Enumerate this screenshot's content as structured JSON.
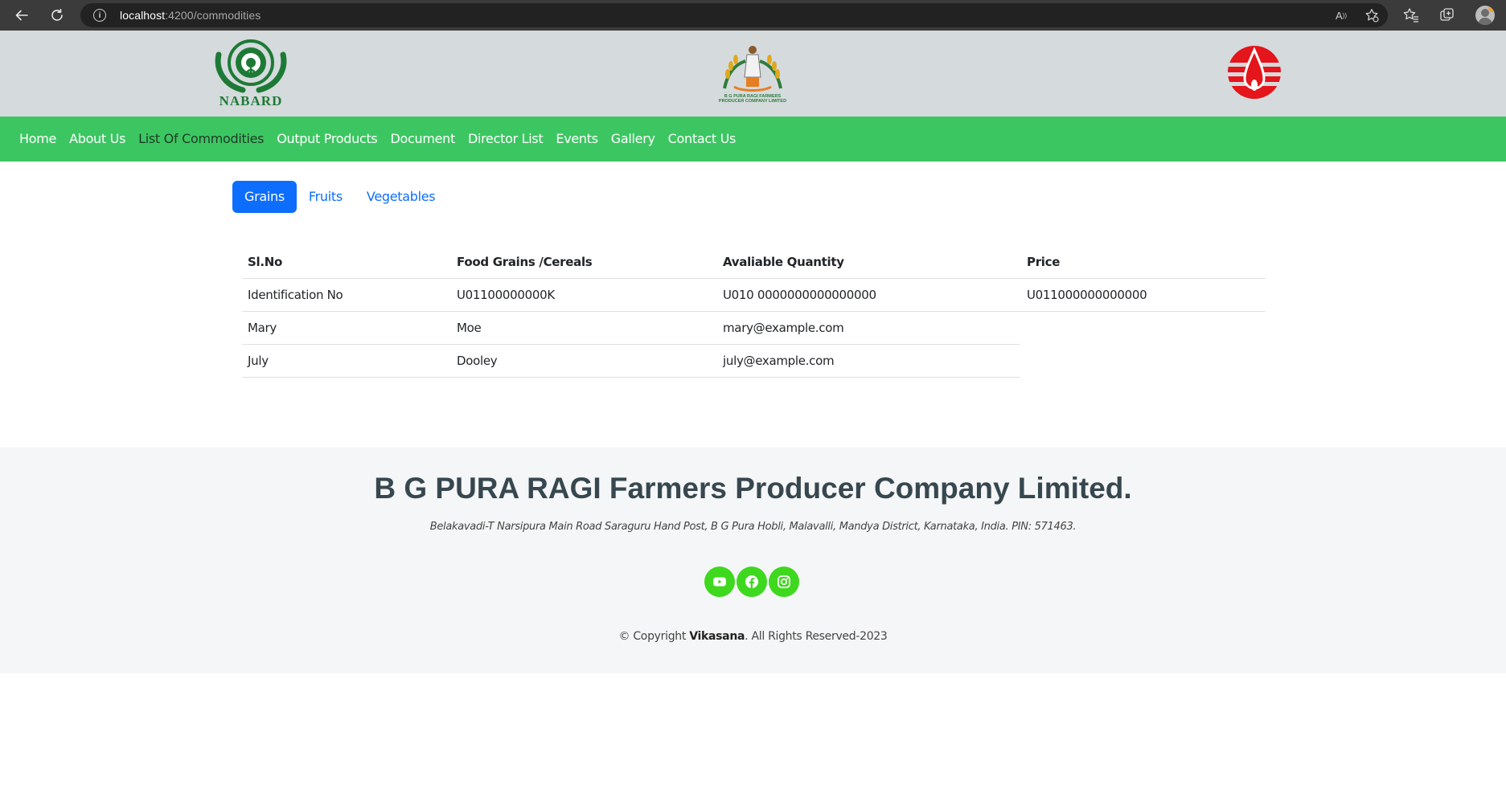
{
  "browser": {
    "url_host": "localhost",
    "url_path": ":4200/commodities"
  },
  "header": {
    "nabard_wordmark": "NABARD",
    "center_logo_caption": "B G PURA RAGI FARMERS PRODUCER COMPANY LIMITED"
  },
  "nav": {
    "items": [
      {
        "label": "Home"
      },
      {
        "label": "About Us"
      },
      {
        "label": "List Of Commodities",
        "active": true
      },
      {
        "label": "Output Products"
      },
      {
        "label": "Document"
      },
      {
        "label": "Director List"
      },
      {
        "label": "Events"
      },
      {
        "label": "Gallery"
      },
      {
        "label": "Contact Us"
      }
    ]
  },
  "tabs": [
    {
      "label": "Grains",
      "active": true
    },
    {
      "label": "Fruits"
    },
    {
      "label": "Vegetables"
    }
  ],
  "table": {
    "headers": [
      "Sl.No",
      "Food Grains /Cereals",
      "Avaliable Quantity",
      "Price"
    ],
    "rows": [
      [
        "Identification No",
        "U01100000000K",
        "U010 0000000000000000",
        "U011000000000000"
      ],
      [
        "Mary",
        "Moe",
        "mary@example.com",
        ""
      ],
      [
        "July",
        "Dooley",
        "july@example.com",
        ""
      ]
    ]
  },
  "footer": {
    "company": "B G PURA RAGI Farmers Producer Company Limited.",
    "address": "Belakavadi-T Narsipura Main Road Saraguru Hand Post, B G Pura Hobli, Malavalli, Mandya District, Karnataka, India. PIN: 571463.",
    "socials": [
      "youtube-icon",
      "facebook-icon",
      "instagram-icon"
    ],
    "copyright_prefix": "© Copyright ",
    "copyright_brand": "Vikasana",
    "copyright_suffix": ". All Rights Reserved-2023"
  },
  "colors": {
    "nav_green": "#3cc662",
    "tab_blue": "#0d6efd",
    "social_green": "#3ed81e",
    "header_bg": "#d5dadd"
  }
}
